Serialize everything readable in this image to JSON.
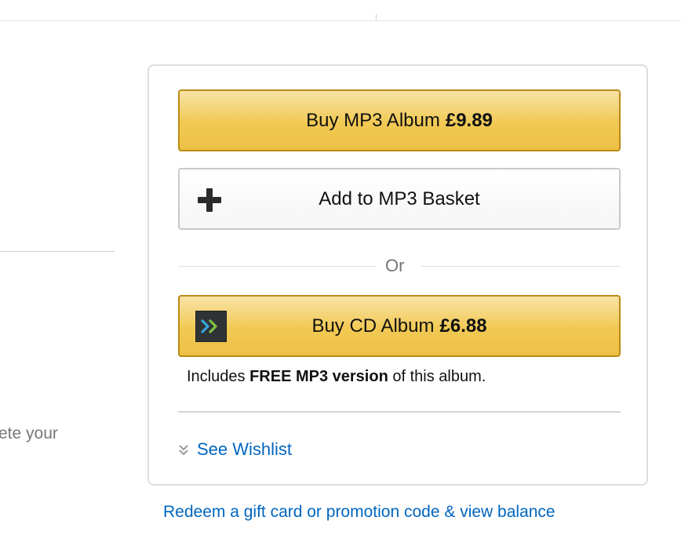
{
  "left_panel": {
    "partial_text": "ete your"
  },
  "buybox": {
    "mp3_button": {
      "label": "Buy MP3 Album",
      "price": "£9.89"
    },
    "basket_button": {
      "label": "Add to MP3 Basket",
      "icon": "plus-icon"
    },
    "or_separator": "Or",
    "cd_button": {
      "label": "Buy CD Album",
      "price": "£6.88",
      "icon": "autorip-icon"
    },
    "includes": {
      "prefix": "Includes",
      "bold": "FREE MP3 version",
      "suffix": "of this album."
    },
    "wishlist": {
      "label": "See Wishlist",
      "icon": "chevron-double-down-icon"
    }
  },
  "redeem_link": "Redeem a gift card or promotion code & view balance",
  "colors": {
    "gold_button": "#f1c953",
    "gold_border": "#b98b16",
    "link": "#0066c0",
    "autorip_arrow_green": "#7fc241",
    "autorip_arrow_blue": "#3aa6dd"
  }
}
